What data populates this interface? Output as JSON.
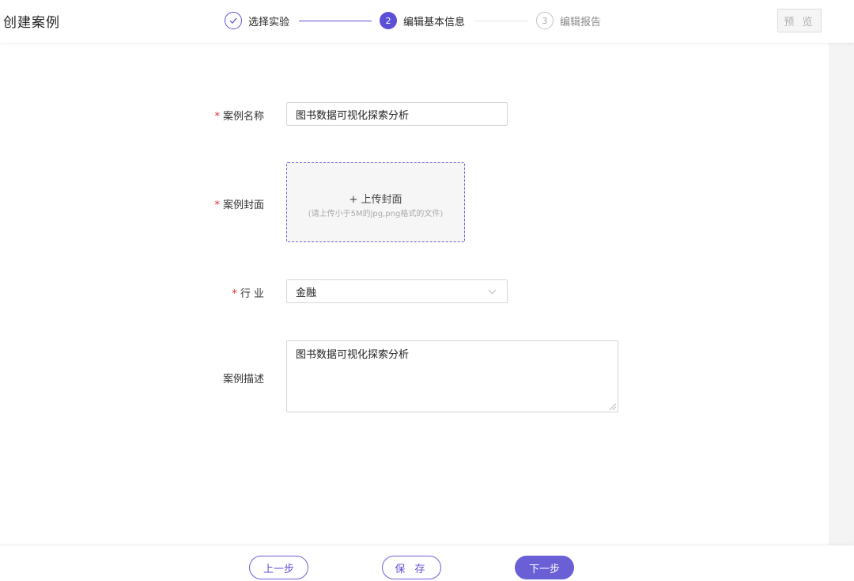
{
  "header": {
    "title": "创建案例",
    "steps": [
      {
        "number": "",
        "label": "选择实验",
        "state": "done"
      },
      {
        "number": "2",
        "label": "编辑基本信息",
        "state": "active"
      },
      {
        "number": "3",
        "label": "编辑报告",
        "state": "pending"
      }
    ],
    "preview_label": "预 览"
  },
  "form": {
    "name": {
      "label": "案例名称",
      "required_mark": "*",
      "value": "图书数据可视化探索分析"
    },
    "cover": {
      "label": "案例封面",
      "required_mark": "*",
      "upload_text": "+ 上传封面",
      "upload_hint": "(请上传小于5M的jpg,png格式的文件)"
    },
    "industry": {
      "label": "行 业",
      "required_mark": "*",
      "value": "金融"
    },
    "description": {
      "label": "案例描述",
      "value": "图书数据可视化探索分析"
    }
  },
  "footer": {
    "prev_label": "上一步",
    "save_label": "保 存",
    "next_label": "下一步"
  },
  "colors": {
    "accent": "#5b4fd6",
    "required": "#e0302c"
  }
}
